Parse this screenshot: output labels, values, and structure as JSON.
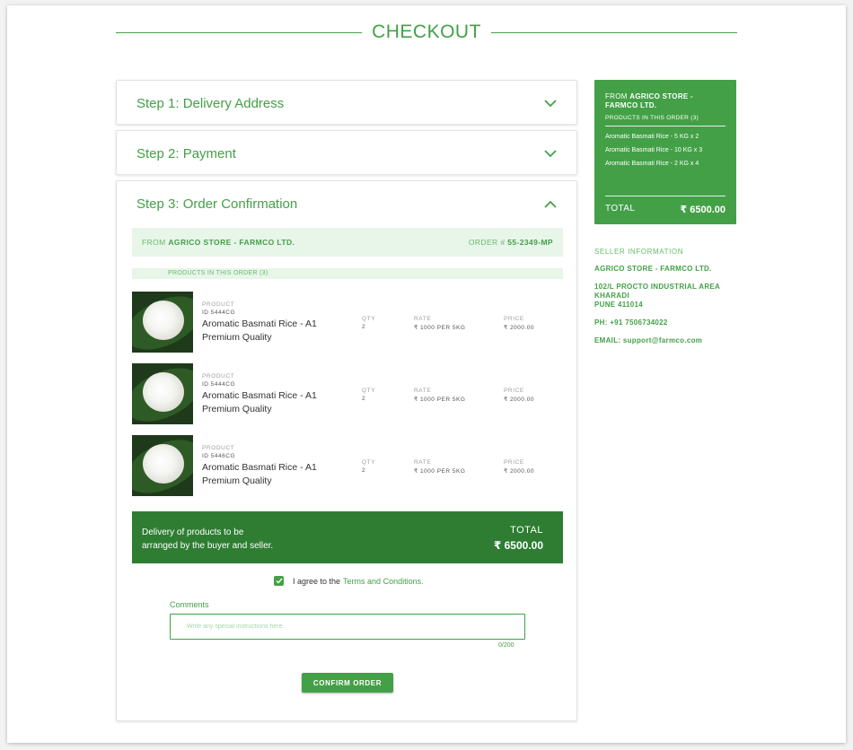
{
  "page": {
    "title": "CHECKOUT"
  },
  "steps": [
    {
      "label": "Step 1: Delivery Address",
      "state": "collapsed"
    },
    {
      "label": "Step 2: Payment",
      "state": "collapsed"
    },
    {
      "label": "Step 3: Order Confirmation",
      "state": "expanded"
    }
  ],
  "confirmation": {
    "from_prefix": "FROM",
    "store_name": "AGRICO STORE - FARMCO LTD.",
    "order_prefix": "ORDER #",
    "order_number": "55-2349-MP",
    "products_header": "PRODUCTS IN THIS ORDER (3)",
    "column_labels": {
      "product": "PRODUCT",
      "qty": "QTY",
      "rate": "RATE",
      "price": "PRICE"
    },
    "items": [
      {
        "id": "ID 5444CG",
        "name": "Aromatic Basmati Rice - A1 Premium Quality",
        "qty": "2",
        "rate": "₹ 1000 PER 5KG",
        "price": "₹ 2000.00"
      },
      {
        "id": "ID 5444CG",
        "name": "Aromatic Basmati Rice - A1 Premium Quality",
        "qty": "2",
        "rate": "₹ 1000 PER 5KG",
        "price": "₹ 2000.00"
      },
      {
        "id": "ID 5446CG",
        "name": "Aromatic Basmati Rice - A1 Premium Quality",
        "qty": "2",
        "rate": "₹ 1000 PER 5KG",
        "price": "₹ 2000.00"
      }
    ],
    "delivery_note_line1": "Delivery of products to be",
    "delivery_note_line2": "arranged by the buyer and seller.",
    "total_label": "TOTAL",
    "total_value": "₹ 6500.00",
    "agree_text": "I agree to the",
    "terms_link": "Terms and Conditions.",
    "agree_checked": true,
    "comments_label": "Comments",
    "comments_value": "",
    "comments_placeholder": "Write any special instructions here.",
    "comments_counter": "0/200",
    "confirm_label": "CONFIRM ORDER"
  },
  "summary": {
    "from_prefix": "FROM",
    "store_line1": "AGRICO STORE -",
    "store_line2": "FARMCO LTD.",
    "products_header": "PRODUCTS IN THIS ORDER (3)",
    "lines": [
      "Aromatic Basmati Rice - 5 KG x 2",
      "Aromatic Basmati Rice - 10 KG x 3",
      "Aromatic Basmati Rice - 2 KG x 4"
    ],
    "total_label": "TOTAL",
    "total_value": "₹ 6500.00"
  },
  "seller": {
    "heading": "SELLER INFORMATION",
    "name": "AGRICO STORE - FARMCO LTD.",
    "address_line1": "102/L PROCTO INDUSTRIAL AREA",
    "address_line2": "KHARADI",
    "address_line3": "PUNE 411014",
    "phone": "PH: +91 7506734022",
    "email": "EMAIL: support@farmco.com"
  },
  "colors": {
    "accent": "#43a047",
    "accent_dark": "#2e7d32",
    "accent_light": "#e8f5e9"
  },
  "icons": {
    "collapsed": "chevron-down-icon",
    "expanded": "chevron-up-icon",
    "checkbox": "check-icon"
  }
}
